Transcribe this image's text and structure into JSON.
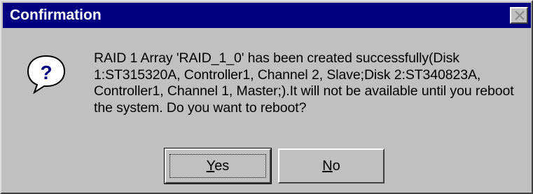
{
  "window": {
    "title": "Confirmation",
    "close_icon": "close-icon"
  },
  "dialog": {
    "icon": "question-icon",
    "message": "RAID 1 Array 'RAID_1_0' has been created successfully(Disk 1:ST315320A, Controller1, Channel 2, Slave;Disk 2:ST340823A, Controller1, Channel 1, Master;).It will not be available until you reboot the system. Do you want to reboot?"
  },
  "buttons": {
    "yes": {
      "mnemonic": "Y",
      "rest": "es"
    },
    "no": {
      "mnemonic": "N",
      "rest": "o"
    }
  },
  "colors": {
    "titlebar": "#000080",
    "face": "#c0c0c0",
    "icon_bubble": "#ffffff",
    "icon_glyph": "#000080"
  }
}
